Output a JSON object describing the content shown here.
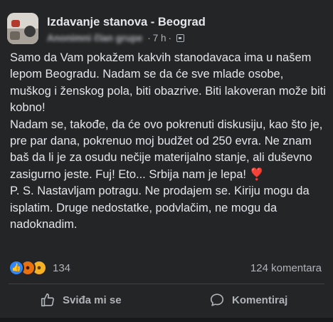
{
  "header": {
    "group_name": "Izdavanje stanova - Beograd",
    "author": "Anonimni član grupe",
    "time": "7 h",
    "separator": "·"
  },
  "post": {
    "text": "Samo da Vam pokažem kakvih stanodavaca ima u našem lepom Beogradu. Nadam se da će sve mlade osobe, muškog i ženskog pola, biti obazrive. Biti lakoveran može biti kobno!\nNadam se, takođe, da će ovo pokrenuti diskusiju, kao što je, pre par dana, pokrenuo moj budžet od 250 evra. Ne znam baš da li je za osudu nečije materijalno stanje, ali duševno zasigurno jeste. Fuj! Eto... Srbija nam je lepa! ❣️\nP. S. Nastavljam potragu. Ne prodajem se. Kiriju mogu da isplatim. Druge nedostatke, podvlačim, ne mogu da nadoknadim."
  },
  "stats": {
    "reaction_count": "134",
    "comment_count": "124 komentara",
    "reaction_icons": [
      "like-icon",
      "angry-icon",
      "haha-icon"
    ]
  },
  "actions": {
    "like_label": "Sviđa mi se",
    "comment_label": "Komentiraj"
  },
  "colors": {
    "background": "#242526",
    "text": "#e4e6eb",
    "secondary_text": "#b0b3b8",
    "like_blue": "#2d88ff",
    "angry_orange": "#e9710f",
    "haha_yellow": "#f7b125"
  }
}
